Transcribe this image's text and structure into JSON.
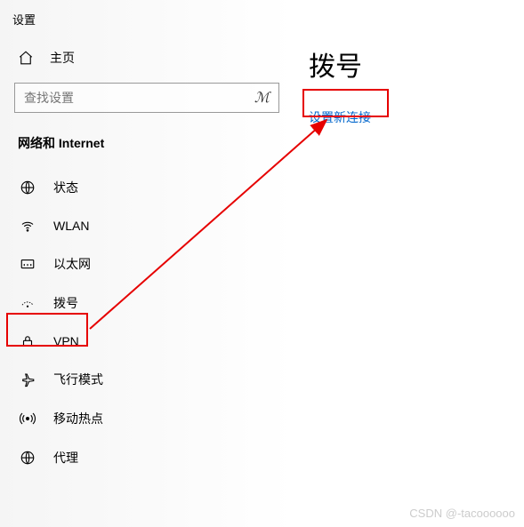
{
  "window": {
    "title": "设置"
  },
  "home": {
    "label": "主页"
  },
  "search": {
    "placeholder": "查找设置"
  },
  "category": {
    "header": "网络和 Internet"
  },
  "nav": {
    "items": [
      {
        "label": "状态"
      },
      {
        "label": "WLAN"
      },
      {
        "label": "以太网"
      },
      {
        "label": "拨号"
      },
      {
        "label": "VPN"
      },
      {
        "label": "飞行模式"
      },
      {
        "label": "移动热点"
      },
      {
        "label": "代理"
      }
    ]
  },
  "main": {
    "title": "拨号",
    "new_connection": "设置新连接"
  },
  "watermark": "CSDN @-tacoooooo"
}
